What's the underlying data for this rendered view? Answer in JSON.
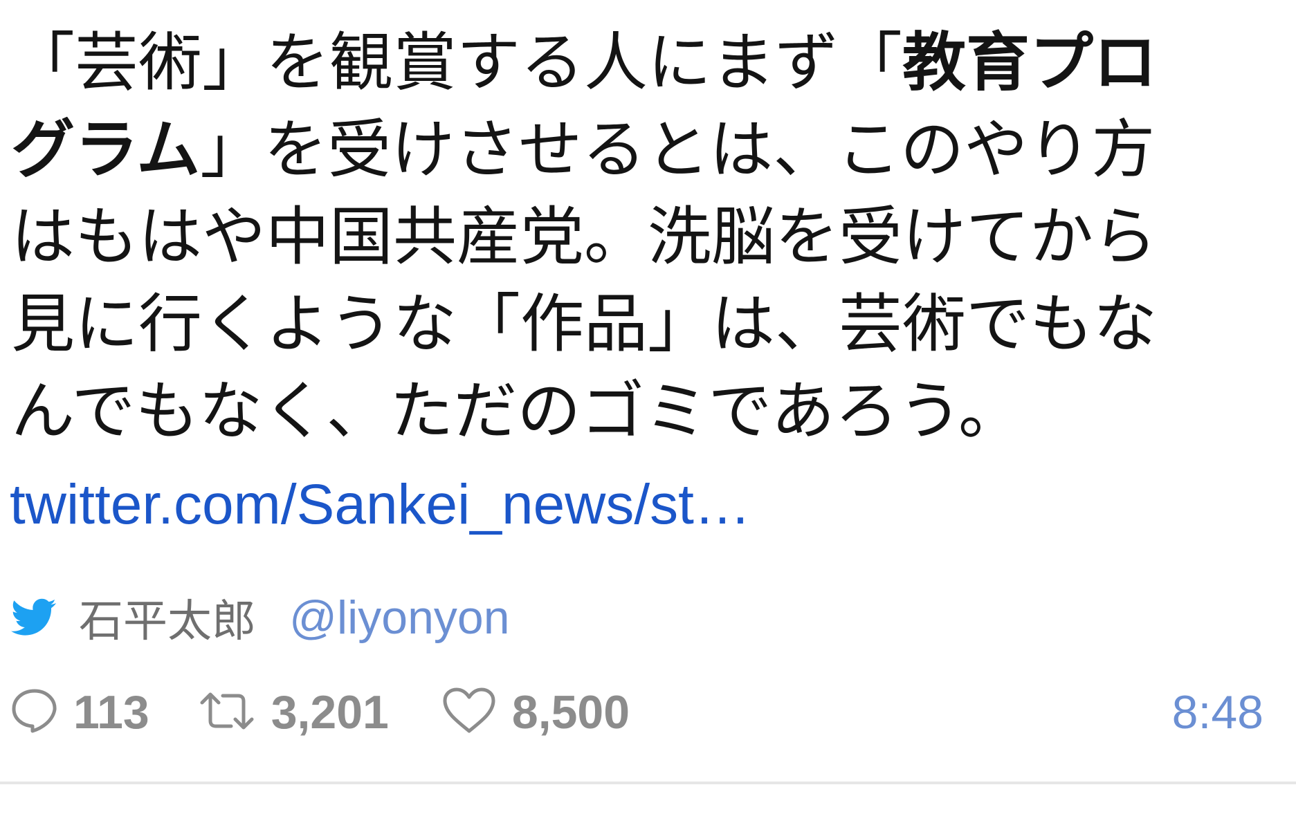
{
  "tweet": {
    "text_segments": {
      "before_bold": "「芸術」を観賞する人にまず「",
      "bold": "教育プログラム",
      "after_bold": "」を受けさせるとは、このやり方はもはや中国共産党。洗脳を受けてから見に行くような「作品」は、芸術でもなんでもなく、ただのゴミであろう。"
    },
    "link_text": "twitter.com/Sankei_news/st…"
  },
  "author": {
    "icon": "twitter-bird-icon",
    "name": "石平太郎",
    "handle": "@liyonyon"
  },
  "actions": {
    "reply": {
      "icon": "reply-bubble-icon",
      "count": "113"
    },
    "retweet": {
      "icon": "retweet-arrows-icon",
      "count": "3,201"
    },
    "like": {
      "icon": "heart-outline-icon",
      "count": "8,500"
    },
    "timestamp": "8:48"
  },
  "colors": {
    "link": "#1b56c9",
    "handle": "#6b8fd3",
    "twitter_blue": "#1da1f2",
    "muted": "#8c8c8c"
  }
}
